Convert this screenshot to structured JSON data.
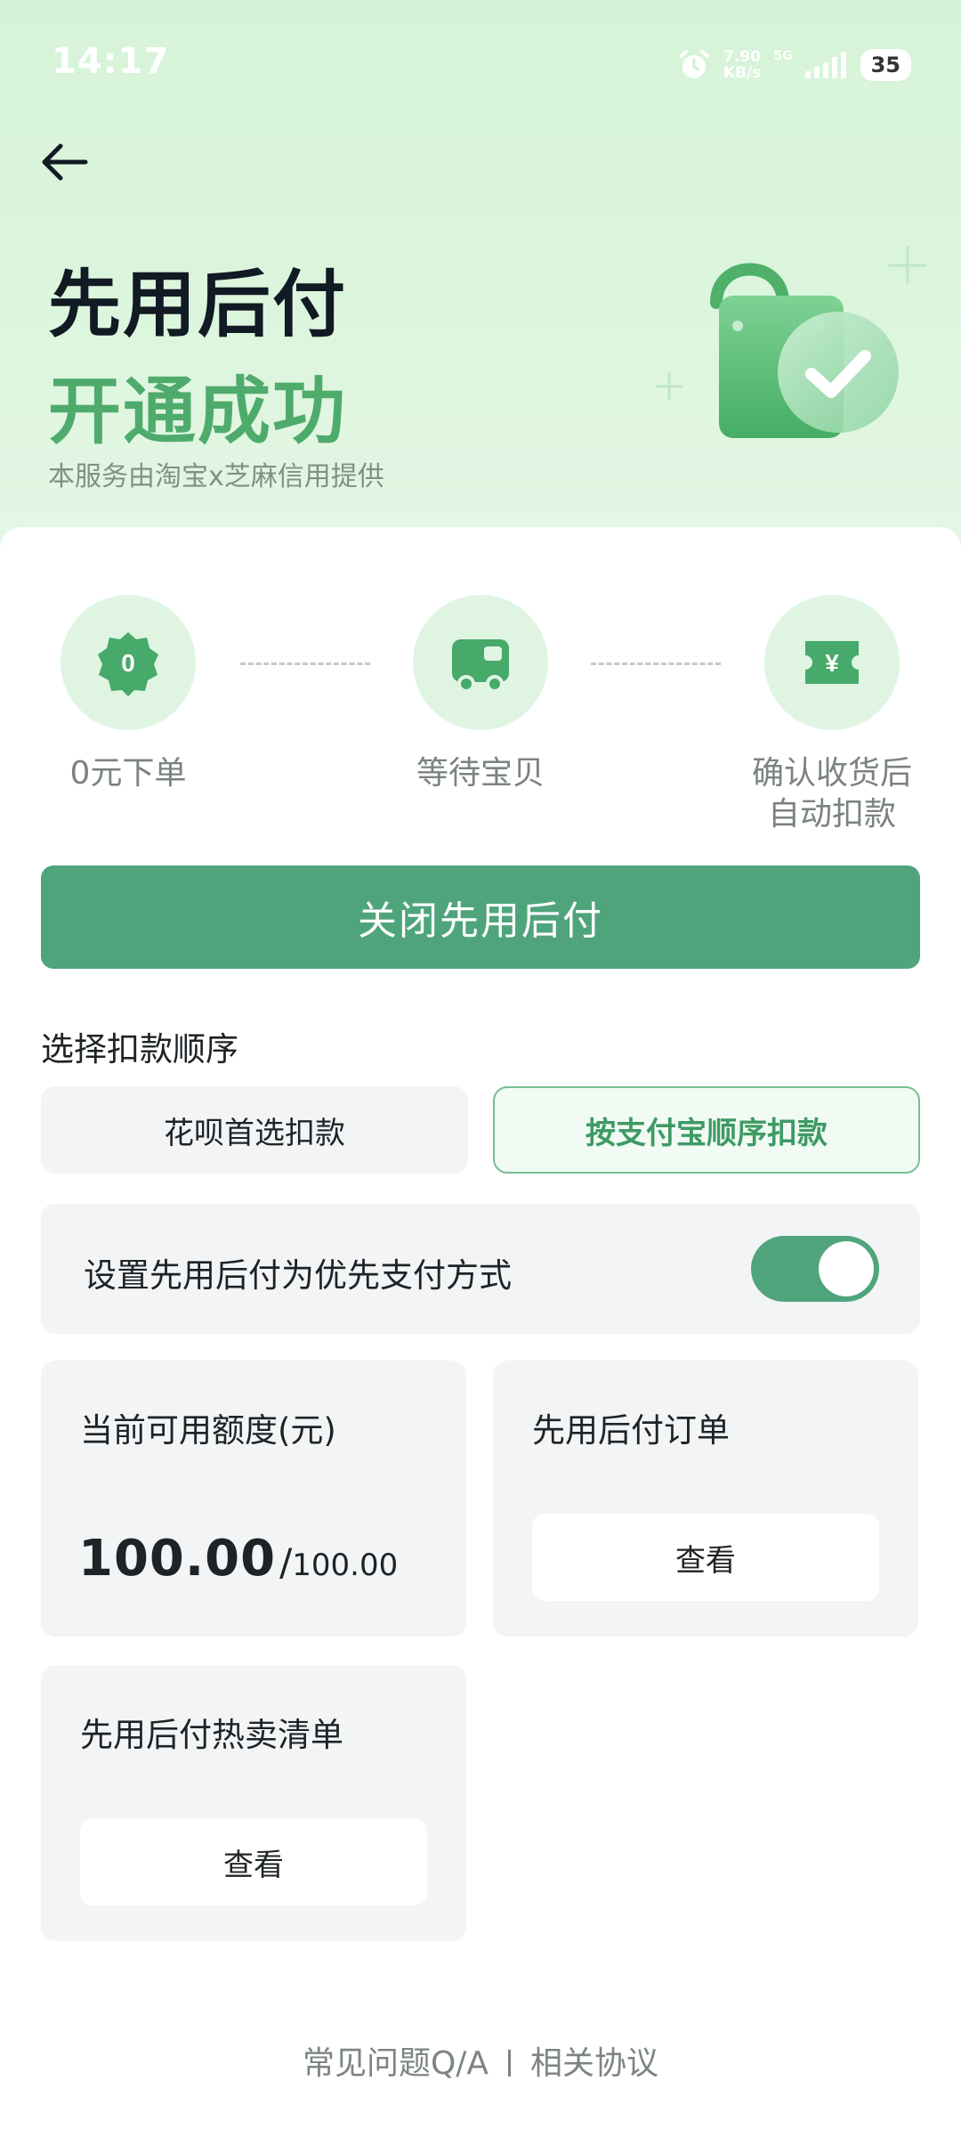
{
  "status_bar": {
    "time": "14:17",
    "net_speed_value": "7.90",
    "net_speed_unit": "KB/s",
    "network_type": "5G",
    "battery": "35"
  },
  "header": {
    "title": "先用后付",
    "subtitle": "开通成功",
    "provider_note": "本服务由淘宝x芝麻信用提供"
  },
  "steps": [
    {
      "badge": "0",
      "label": "0元下单",
      "icon": "badge-zero-icon"
    },
    {
      "label": "等待宝贝",
      "icon": "truck-icon"
    },
    {
      "badge": "¥",
      "label": "确认收货后自动扣款",
      "label_line1": "确认收货后",
      "label_line2": "自动扣款",
      "icon": "yen-ticket-icon"
    }
  ],
  "close_button_label": "关闭先用后付",
  "deduction": {
    "section_title": "选择扣款顺序",
    "options": [
      {
        "label": "花呗首选扣款",
        "selected": false
      },
      {
        "label": "按支付宝顺序扣款",
        "selected": true
      }
    ]
  },
  "preference": {
    "label": "设置先用后付为优先支付方式",
    "enabled": true
  },
  "credit": {
    "title": "当前可用额度(元)",
    "available": "100.00",
    "separator": "/",
    "total": "100.00"
  },
  "orders": {
    "title": "先用后付订单",
    "button_label": "查看"
  },
  "hot_list": {
    "title": "先用后付热卖清单",
    "button_label": "查看"
  },
  "footer": {
    "faq_label": "常见问题Q/A",
    "agreement_label": "相关协议"
  },
  "colors": {
    "brand_green": "#4fa47c",
    "title_green": "#4fab6c",
    "header_bg": "#d6f3d8",
    "step_circle_bg": "#dff5e2"
  }
}
